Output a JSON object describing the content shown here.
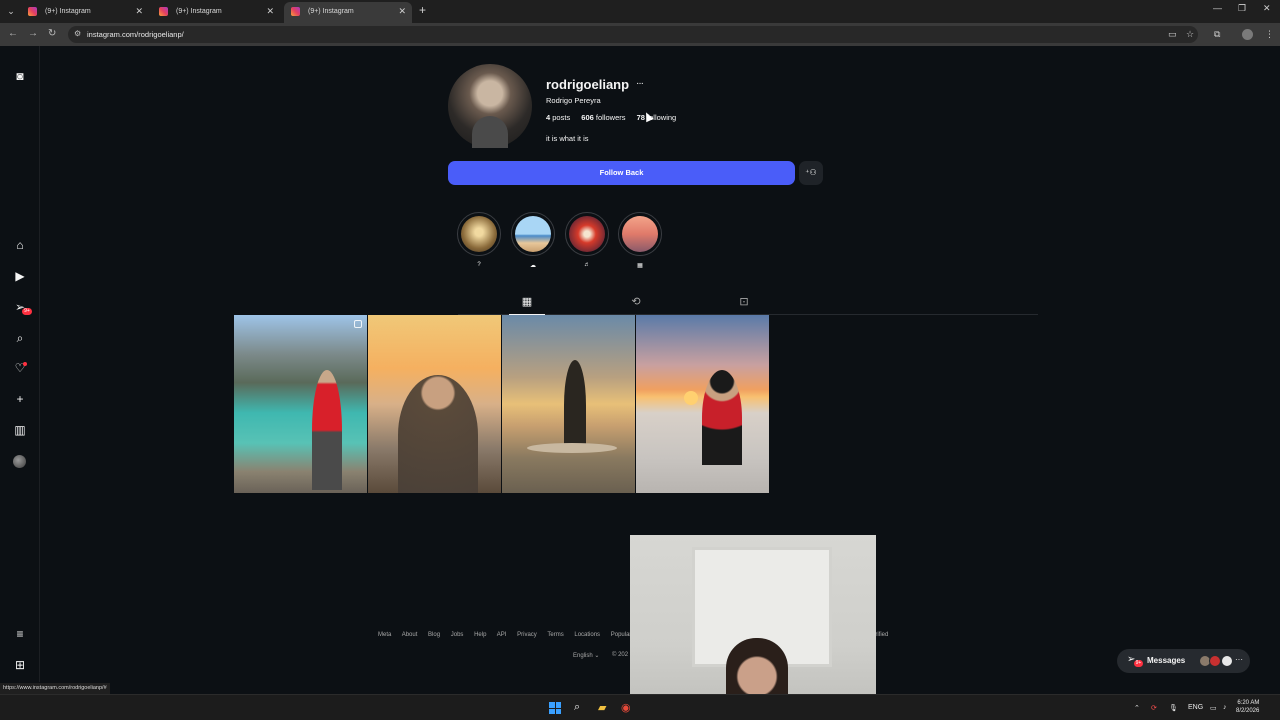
{
  "browser": {
    "tabs": [
      {
        "title": "(9+) Instagram",
        "active": false
      },
      {
        "title": "(9+) Instagram",
        "active": false
      },
      {
        "title": "(9+) Instagram",
        "active": true
      }
    ],
    "url": "instagram.com/rodrigoelianp/",
    "status_url": "https://www.instagram.com/rodrigoelianp/#"
  },
  "sidebar": {
    "notifications_badge": "9+"
  },
  "profile": {
    "username": "rodrigoelianp",
    "full_name": "Rodrigo Pereyra",
    "stats": {
      "posts_count": "4",
      "posts_label": "posts",
      "followers_count": "606",
      "followers_label": "followers",
      "following_count": "78",
      "following_label": "following"
    },
    "bio": "it is what it is",
    "follow_button": "Follow Back"
  },
  "highlights": [
    {
      "label": "?",
      "colors": [
        "#f1d9a0",
        "#8a6a3a"
      ]
    },
    {
      "label": "☁",
      "colors": [
        "#a9d6f5",
        "#e7c79a"
      ]
    },
    {
      "label": "♬",
      "colors": [
        "#d63a2a",
        "#2a1b3a"
      ]
    },
    {
      "label": "▦",
      "colors": [
        "#f3a48a",
        "#8a5a6a"
      ]
    }
  ],
  "footer": {
    "links": [
      "Meta",
      "About",
      "Blog",
      "Jobs",
      "Help",
      "API",
      "Privacy",
      "Terms",
      "Locations",
      "Popular"
    ],
    "links_tail": "erified",
    "language": "English ⌄",
    "copyright": "© 202"
  },
  "messages": {
    "label": "Messages",
    "badge": "9+"
  },
  "taskbar": {
    "lang": "ENG",
    "time": "6:20 AM",
    "date": "8/2/2026"
  },
  "colors": {
    "background": "#0c1014",
    "accent": "#4a5df9",
    "badge": "#ff3040"
  }
}
